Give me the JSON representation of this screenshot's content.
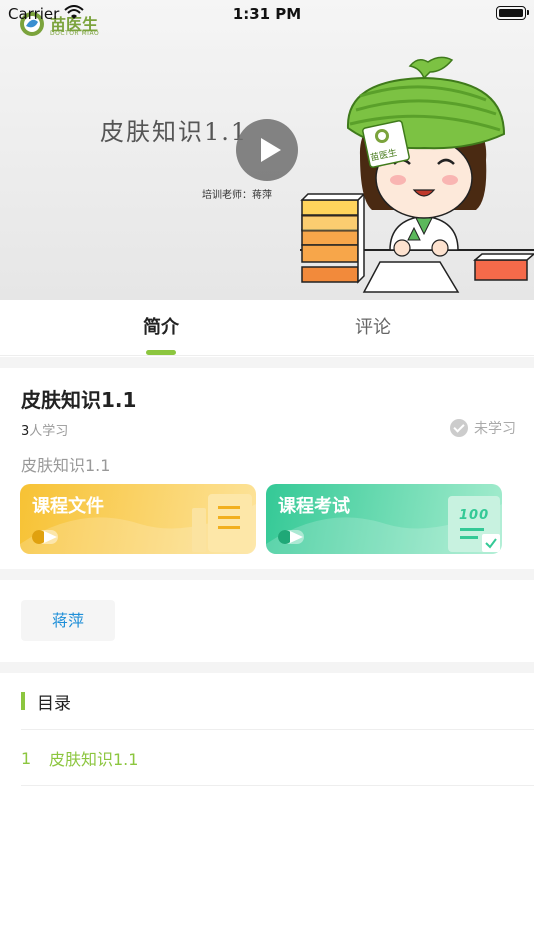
{
  "status_bar": {
    "carrier": "Carrier",
    "time": "1:31 PM"
  },
  "video": {
    "logo_text": "苗医生",
    "logo_sub": "DOCTOR MIAO",
    "title": "皮肤知识1.1",
    "teacher_line": "培训老师：蒋萍",
    "hat_badge": "苗医生"
  },
  "tabs": {
    "intro": "简介",
    "comment": "评论"
  },
  "course": {
    "title": "皮肤知识1.1",
    "learner_count": "3",
    "learner_suffix": "人学习",
    "status": "未学习",
    "description": "皮肤知识1.1"
  },
  "cards": {
    "files_label": "课程文件",
    "exam_label": "课程考试",
    "exam_score": "100"
  },
  "teacher": {
    "name": "蒋萍"
  },
  "catalog": {
    "title": "目录",
    "items": [
      {
        "index": "1",
        "title": "皮肤知识1.1"
      }
    ]
  },
  "colors": {
    "accent_green": "#8cc63f",
    "link_blue": "#1f8fd8",
    "files_card": "#f7c234",
    "exam_card": "#34c996"
  }
}
